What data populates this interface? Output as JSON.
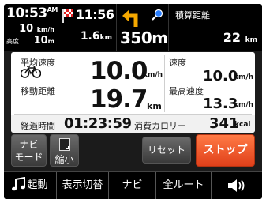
{
  "status": {
    "clock": {
      "time": "10:53",
      "ampm": "AM"
    },
    "speed": {
      "value": "10",
      "unit": "km/h"
    },
    "altitude": {
      "label": "高度",
      "value": "10",
      "unit": "m"
    },
    "destination": {
      "eta": "11:56",
      "distance": "1.6",
      "unit": "km"
    },
    "turn": {
      "distance": "350m"
    },
    "total": {
      "label": "積算距離",
      "value": "22",
      "unit": "km"
    }
  },
  "stats": {
    "avg_speed": {
      "label": "平均速度",
      "value": "10.0",
      "unit": "km/h"
    },
    "speed": {
      "label": "速度",
      "value": "10.0",
      "unit": "km/h"
    },
    "moving_distance": {
      "label": "移動距離",
      "value": "19.7",
      "unit": "km"
    },
    "max_speed": {
      "label": "最高速度",
      "value": "13.3",
      "unit": "km/h"
    },
    "elapsed": {
      "label": "経過時間",
      "value": "01:23:59"
    },
    "calories": {
      "label": "消費カロリー",
      "value": "341",
      "unit": "kcal"
    }
  },
  "controls": {
    "navi_mode": {
      "line1": "ナビ",
      "line2": "モード"
    },
    "shrink": "縮小",
    "reset": "リセット",
    "stop": "ストップ"
  },
  "bottom_bar": {
    "music": "起動",
    "route_switch": "表示切替",
    "navi": "ナビ",
    "all_route": "全ルート"
  },
  "colors": {
    "stop_button": "#e0401a",
    "flag": "#e02020",
    "turn_arrow": "#f5a800",
    "search_icon": "#2a7fff"
  },
  "icons": [
    "flag-icon",
    "turn-arrow-icon",
    "search-icon",
    "bicycle-icon",
    "map-shrink-icon",
    "music-note-icon",
    "volume-icon"
  ]
}
